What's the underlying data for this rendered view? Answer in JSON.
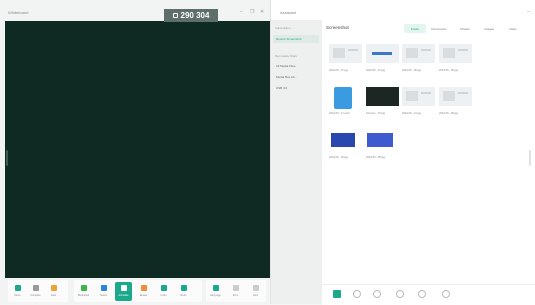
{
  "whiteboard": {
    "title": "Whiteboard",
    "controls": [
      "–",
      "❐",
      "✕"
    ],
    "coordinate_readout": "290 304",
    "toolbar": [
      {
        "label": "Menu",
        "icon": "menu-icon",
        "color": "#1aa98a"
      },
      {
        "label": "Compare",
        "icon": "compare-icon",
        "color": "#999999"
      },
      {
        "label": "Files",
        "icon": "files-icon",
        "color": "#e8a33a"
      },
      {
        "label": "Bookshelf",
        "icon": "bookshelf-icon",
        "color": "#3bb54a"
      },
      {
        "label": "Select",
        "icon": "select-icon",
        "color": "#2b84d8"
      },
      {
        "label": "Annotate",
        "icon": "pen-icon",
        "color": "#ffffff",
        "active": true
      },
      {
        "label": "Eraser",
        "icon": "eraser-icon",
        "color": "#ef8c3a"
      },
      {
        "label": "Undo",
        "icon": "undo-icon",
        "color": "#1aa98a"
      },
      {
        "label": "Redo",
        "icon": "redo-icon",
        "color": "#1aa98a"
      },
      {
        "label": "Add page",
        "icon": "add-page-icon",
        "color": "#1aa98a"
      },
      {
        "label": "Prev",
        "icon": "prev-icon",
        "color": "#cccccc"
      },
      {
        "label": "Next",
        "icon": "next-icon",
        "color": "#cccccc"
      }
    ]
  },
  "assistant": {
    "title": "Assistant",
    "sidebar": {
      "section1_caption": "Subscription",
      "section1_items": [
        "Recent Screenshot"
      ],
      "section2_caption": "Removable Disks",
      "section2_items": [
        "All Media Files",
        "Media Box Ab...",
        "USB 3.0"
      ]
    },
    "content_title": "Screenshot",
    "filter_tabs": [
      "Folder",
      "Documents",
      "Photos",
      "Images",
      "Video"
    ],
    "thumbnails": [
      {
        "caption": "2024-05 - 07.jpg",
        "style": "doc"
      },
      {
        "caption": "2024-05 - 07.jpg",
        "style": "blueline"
      },
      {
        "caption": "2024-05 - 06.jpg",
        "style": "doc"
      },
      {
        "caption": "2024-05 - 05.jpg",
        "style": "doc"
      },
      {
        "caption": "2024-05 - 17.mp4",
        "style": "file"
      },
      {
        "caption": "Screens - 07.jpg",
        "style": "dark"
      },
      {
        "caption": "2024-05 - 13.jpg",
        "style": "doc"
      },
      {
        "caption": "2024-05 - 09.jpg",
        "style": "doc"
      },
      {
        "caption": "2024-05 - 09.jpg",
        "style": "bluebox"
      },
      {
        "caption": "2024-05 - 08.jpg",
        "style": "bluebox2"
      }
    ],
    "bottom_tools": [
      "grid-icon",
      "list-icon",
      "folder-icon",
      "clock-icon",
      "back-icon",
      "settings-icon"
    ]
  }
}
